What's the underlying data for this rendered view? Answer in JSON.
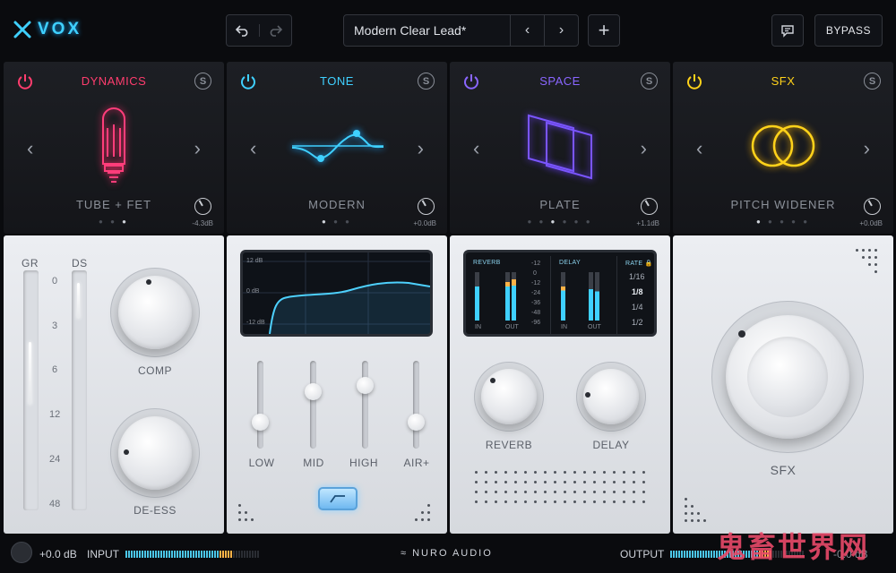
{
  "app": {
    "logo_text": "VOX",
    "accent": "#3fd0ff"
  },
  "toolbar": {
    "preset_name": "Modern Clear Lead*",
    "bypass_label": "BYPASS",
    "add_label": "+"
  },
  "modules": [
    {
      "title": "DYNAMICS",
      "color": "#ff3d6e",
      "solo": "S",
      "preset": "TUBE + FET",
      "gain": "-4.3dB"
    },
    {
      "title": "TONE",
      "color": "#3fd0ff",
      "solo": "S",
      "preset": "MODERN",
      "gain": "+0.0dB"
    },
    {
      "title": "SPACE",
      "color": "#7a55ff",
      "solo": "S",
      "preset": "PLATE",
      "gain": "+1.1dB"
    },
    {
      "title": "SFX",
      "color": "#ffd21a",
      "solo": "S",
      "preset": "PITCH WIDENER",
      "gain": "+0.0dB"
    }
  ],
  "dynamics_panel": {
    "gr_label": "GR",
    "ds_label": "DS",
    "scale": [
      "0",
      "3",
      "6",
      "12",
      "24",
      "48"
    ],
    "comp_label": "COMP",
    "deess_label": "DE-ESS"
  },
  "tone_panel": {
    "eq_scale": [
      "12 dB",
      "0 dB",
      "-12 dB"
    ],
    "bands": [
      "LOW",
      "MID",
      "HIGH",
      "AIR+"
    ]
  },
  "space_panel": {
    "reverb_label": "REVERB",
    "delay_label": "DELAY",
    "rate_label": "RATE",
    "meter_scale": [
      "-12",
      "0",
      "-12",
      "-24",
      "-36",
      "-48",
      "-96"
    ],
    "in_label": "IN",
    "out_label": "OUT",
    "rates": [
      "1/16",
      "1/8",
      "1/4",
      "1/2"
    ],
    "selected_rate": "1/8"
  },
  "sfx_panel": {
    "label": "SFX"
  },
  "footer": {
    "input_value": "+0.0 dB",
    "input_label": "INPUT",
    "brand": "NURO AUDIO",
    "output_label": "OUTPUT",
    "output_value": "-0.0 dB",
    "watermark": "鬼畜世界网"
  }
}
